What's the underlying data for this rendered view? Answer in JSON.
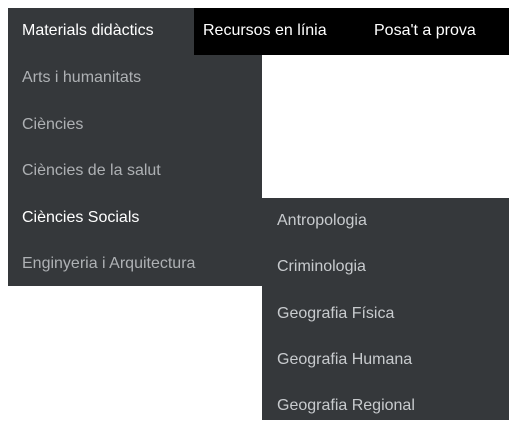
{
  "topnav": {
    "items": [
      {
        "label": "Materials didàctics"
      },
      {
        "label": "Recursos en línia"
      },
      {
        "label": "Posa't a prova"
      }
    ]
  },
  "dropdown": {
    "items": [
      {
        "label": "Arts i humanitats"
      },
      {
        "label": "Ciències"
      },
      {
        "label": "Ciències de la salut"
      },
      {
        "label": "Ciències Socials"
      },
      {
        "label": "Enginyeria i Arquitectura"
      }
    ]
  },
  "submenu": {
    "items": [
      {
        "label": "Antropologia"
      },
      {
        "label": "Criminologia"
      },
      {
        "label": "Geografia Física"
      },
      {
        "label": "Geografia Humana"
      },
      {
        "label": "Geografia Regional"
      }
    ]
  },
  "colors": {
    "topbar_bg": "#000000",
    "menu_bg": "#35383b",
    "text_active": "#ffffff",
    "text_inactive": "#aeb1b4"
  }
}
